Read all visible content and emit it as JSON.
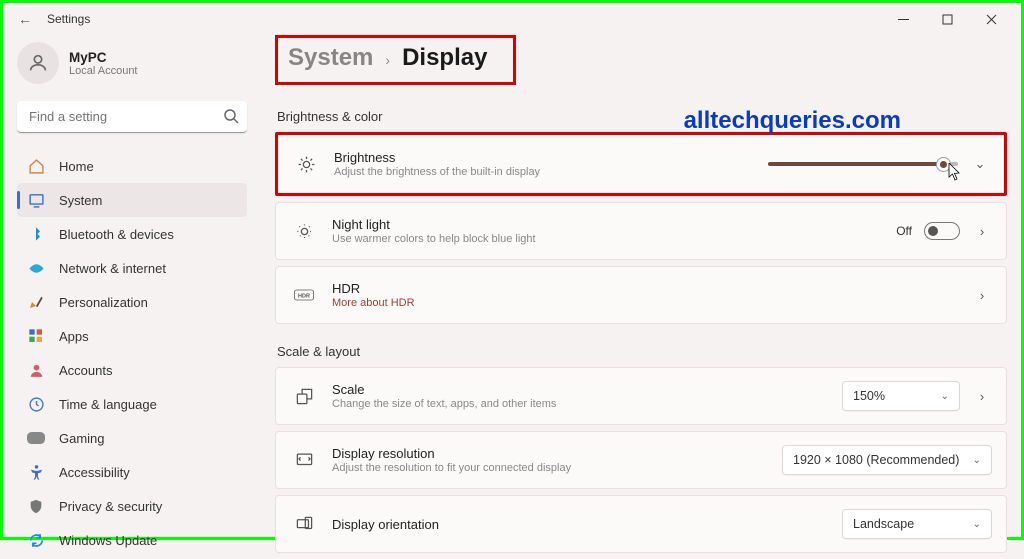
{
  "titlebar": {
    "title": "Settings"
  },
  "user": {
    "name": "MyPC",
    "sub": "Local Account"
  },
  "search": {
    "placeholder": "Find a setting"
  },
  "sidebar": {
    "items": [
      {
        "label": "Home",
        "icon": "home"
      },
      {
        "label": "System",
        "icon": "system",
        "selected": true
      },
      {
        "label": "Bluetooth & devices",
        "icon": "bluetooth"
      },
      {
        "label": "Network & internet",
        "icon": "network"
      },
      {
        "label": "Personalization",
        "icon": "personalization"
      },
      {
        "label": "Apps",
        "icon": "apps"
      },
      {
        "label": "Accounts",
        "icon": "accounts"
      },
      {
        "label": "Time & language",
        "icon": "time"
      },
      {
        "label": "Gaming",
        "icon": "gaming"
      },
      {
        "label": "Accessibility",
        "icon": "accessibility"
      },
      {
        "label": "Privacy & security",
        "icon": "privacy"
      },
      {
        "label": "Windows Update",
        "icon": "update"
      }
    ]
  },
  "breadcrumb": {
    "parent": "System",
    "current": "Display"
  },
  "watermark": "alltechqueries.com",
  "sections": {
    "brightness_color": "Brightness & color",
    "scale_layout": "Scale & layout"
  },
  "cards": {
    "brightness": {
      "title": "Brightness",
      "sub": "Adjust the brightness of the built-in display"
    },
    "nightlight": {
      "title": "Night light",
      "sub": "Use warmer colors to help block blue light",
      "state": "Off"
    },
    "hdr": {
      "title": "HDR",
      "link": "More about HDR"
    },
    "scale": {
      "title": "Scale",
      "sub": "Change the size of text, apps, and other items",
      "value": "150%"
    },
    "resolution": {
      "title": "Display resolution",
      "sub": "Adjust the resolution to fit your connected display",
      "value": "1920 × 1080 (Recommended)"
    },
    "orientation": {
      "title": "Display orientation",
      "value": "Landscape"
    }
  }
}
